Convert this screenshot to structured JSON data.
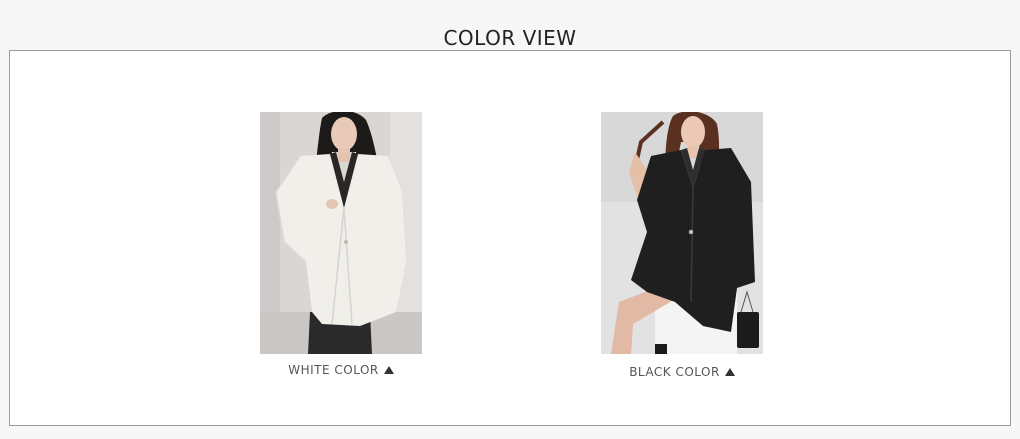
{
  "header": {
    "title": "COLOR VIEW"
  },
  "colors": [
    {
      "label": "WHITE COLOR",
      "icon": "triangle-up-icon",
      "swatch": "#ecebe6"
    },
    {
      "label": "BLACK COLOR",
      "icon": "triangle-up-icon",
      "swatch": "#1c1c1c"
    }
  ]
}
